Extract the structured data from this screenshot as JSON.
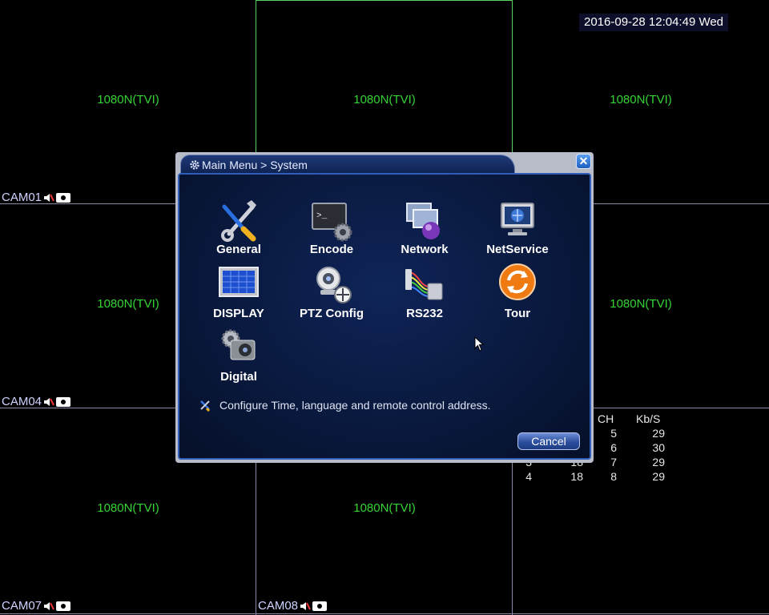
{
  "clock": "2016-09-28 12:04:49 Wed",
  "cameras": [
    {
      "resolution": "1080N(TVI)",
      "label": "CAM01"
    },
    {
      "resolution": "1080N(TVI)",
      "label": ""
    },
    {
      "resolution": "1080N(TVI)",
      "label": ""
    },
    {
      "resolution": "1080N(TVI)",
      "label": "CAM04"
    },
    {
      "resolution": "",
      "label": ""
    },
    {
      "resolution": "1080N(TVI)",
      "label": ""
    },
    {
      "resolution": "1080N(TVI)",
      "label": "CAM07"
    },
    {
      "resolution": "1080N(TVI)",
      "label": "CAM08"
    },
    {
      "resolution": "",
      "label": ""
    }
  ],
  "stats": {
    "headers": [
      "CH",
      "Kb/S"
    ],
    "rows": [
      {
        "a": "",
        "b": "",
        "ch": "5",
        "kbs": "29"
      },
      {
        "a": "",
        "b": "",
        "ch": "6",
        "kbs": "30"
      },
      {
        "a": "3",
        "b": "18",
        "ch": "7",
        "kbs": "29"
      },
      {
        "a": "4",
        "b": "18",
        "ch": "8",
        "kbs": "29"
      }
    ]
  },
  "dialog": {
    "breadcrumb": "Main Menu > System",
    "close": "✕",
    "items": [
      {
        "label": "General",
        "icon": "general-tools-icon"
      },
      {
        "label": "Encode",
        "icon": "encode-terminal-icon"
      },
      {
        "label": "Network",
        "icon": "network-icon"
      },
      {
        "label": "NetService",
        "icon": "netservice-monitor-icon"
      },
      {
        "label": "DISPLAY",
        "icon": "display-screen-icon"
      },
      {
        "label": "PTZ Config",
        "icon": "ptz-camera-icon"
      },
      {
        "label": "RS232",
        "icon": "rs232-cable-icon"
      },
      {
        "label": "Tour",
        "icon": "tour-refresh-icon"
      },
      {
        "label": "Digital",
        "icon": "digital-camera-icon"
      }
    ],
    "hint": "Configure Time, language and remote control address.",
    "cancel": "Cancel"
  },
  "colors": {
    "resolution_text": "#35d435",
    "grid_line": "#8a8aa8",
    "active_border": "#5fd35f",
    "panel_bg": "#081637"
  }
}
